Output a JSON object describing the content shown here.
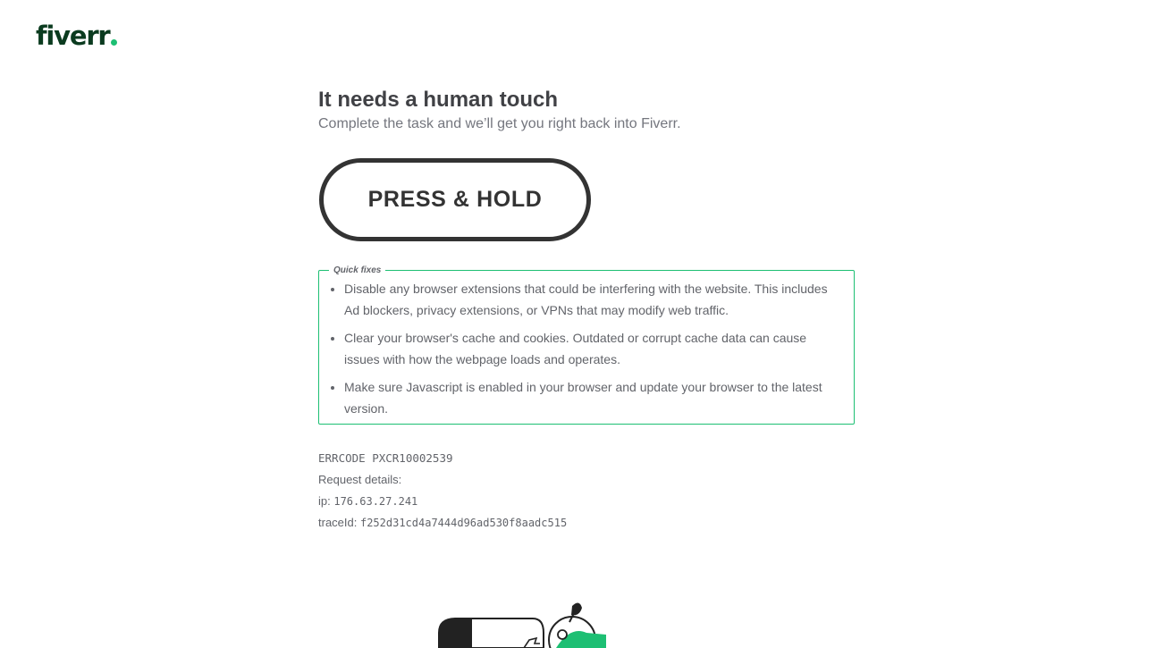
{
  "brand": {
    "logo_text": "fiverr",
    "accent_color": "#1dbf73",
    "logo_color": "#0b3b1f"
  },
  "main": {
    "title": "It needs a human touch",
    "subtitle": "Complete the task and we’ll get you right back into Fiverr.",
    "hold_button_label": "PRESS & HOLD"
  },
  "quick_fixes": {
    "legend": "Quick fixes",
    "items": [
      "Disable any browser extensions that could be interfering with the website. This includes Ad blockers, privacy extensions, or VPNs that may modify web traffic.",
      "Clear your browser's cache and cookies. Outdated or corrupt cache data can cause issues with how the webpage loads and operates.",
      "Make sure Javascript is enabled in your browser and update your browser to the latest version."
    ]
  },
  "details": {
    "error_code": "ERRCODE PXCR10002539",
    "request_details_label": "Request details:",
    "ip_label": "ip:",
    "ip_value": "176.63.27.241",
    "trace_label": "traceId:",
    "trace_value": "f252d31cd4a7444d96ad530f8aadc515"
  }
}
